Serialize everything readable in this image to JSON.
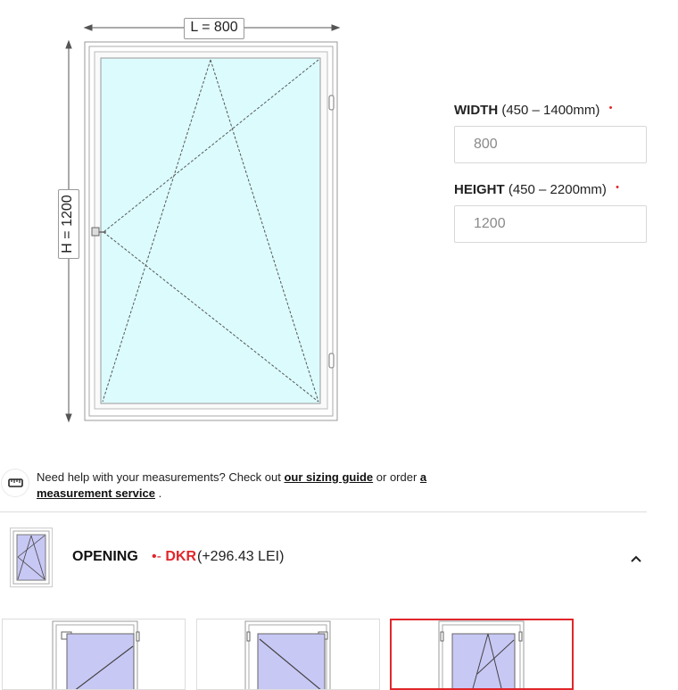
{
  "dimensions": {
    "width_label": "L = 800",
    "height_label": "H = 1200"
  },
  "fields": {
    "width": {
      "name": "WIDTH",
      "range": "(450 – 1400mm)",
      "required_mark": "•",
      "value": "800"
    },
    "height": {
      "name": "HEIGHT",
      "range": "(450 – 2200mm)",
      "required_mark": "•",
      "value": "1200"
    }
  },
  "help": {
    "icon": "ruler-icon",
    "text_before": "Need help with your measurements? Check out ",
    "link_sizing_guide": "our sizing guide",
    "text_middle": " or order ",
    "link_measurement_service": "a measurement service",
    "text_after": " ."
  },
  "opening": {
    "title": "OPENING",
    "type_marker": "•-",
    "type": "DKR",
    "price": "(+296.43 LEI)",
    "toggle_icon": "chevron-up-icon"
  },
  "opening_options": [
    {
      "icon": "window-option-icon",
      "selected": false
    },
    {
      "icon": "window-option-icon",
      "selected": false
    },
    {
      "icon": "window-tilt-turn-icon",
      "selected": true
    }
  ],
  "colors": {
    "glass": "#dcfbfd",
    "accent_red": "#e0262a",
    "thumb_glass": "#c8c8f5"
  }
}
